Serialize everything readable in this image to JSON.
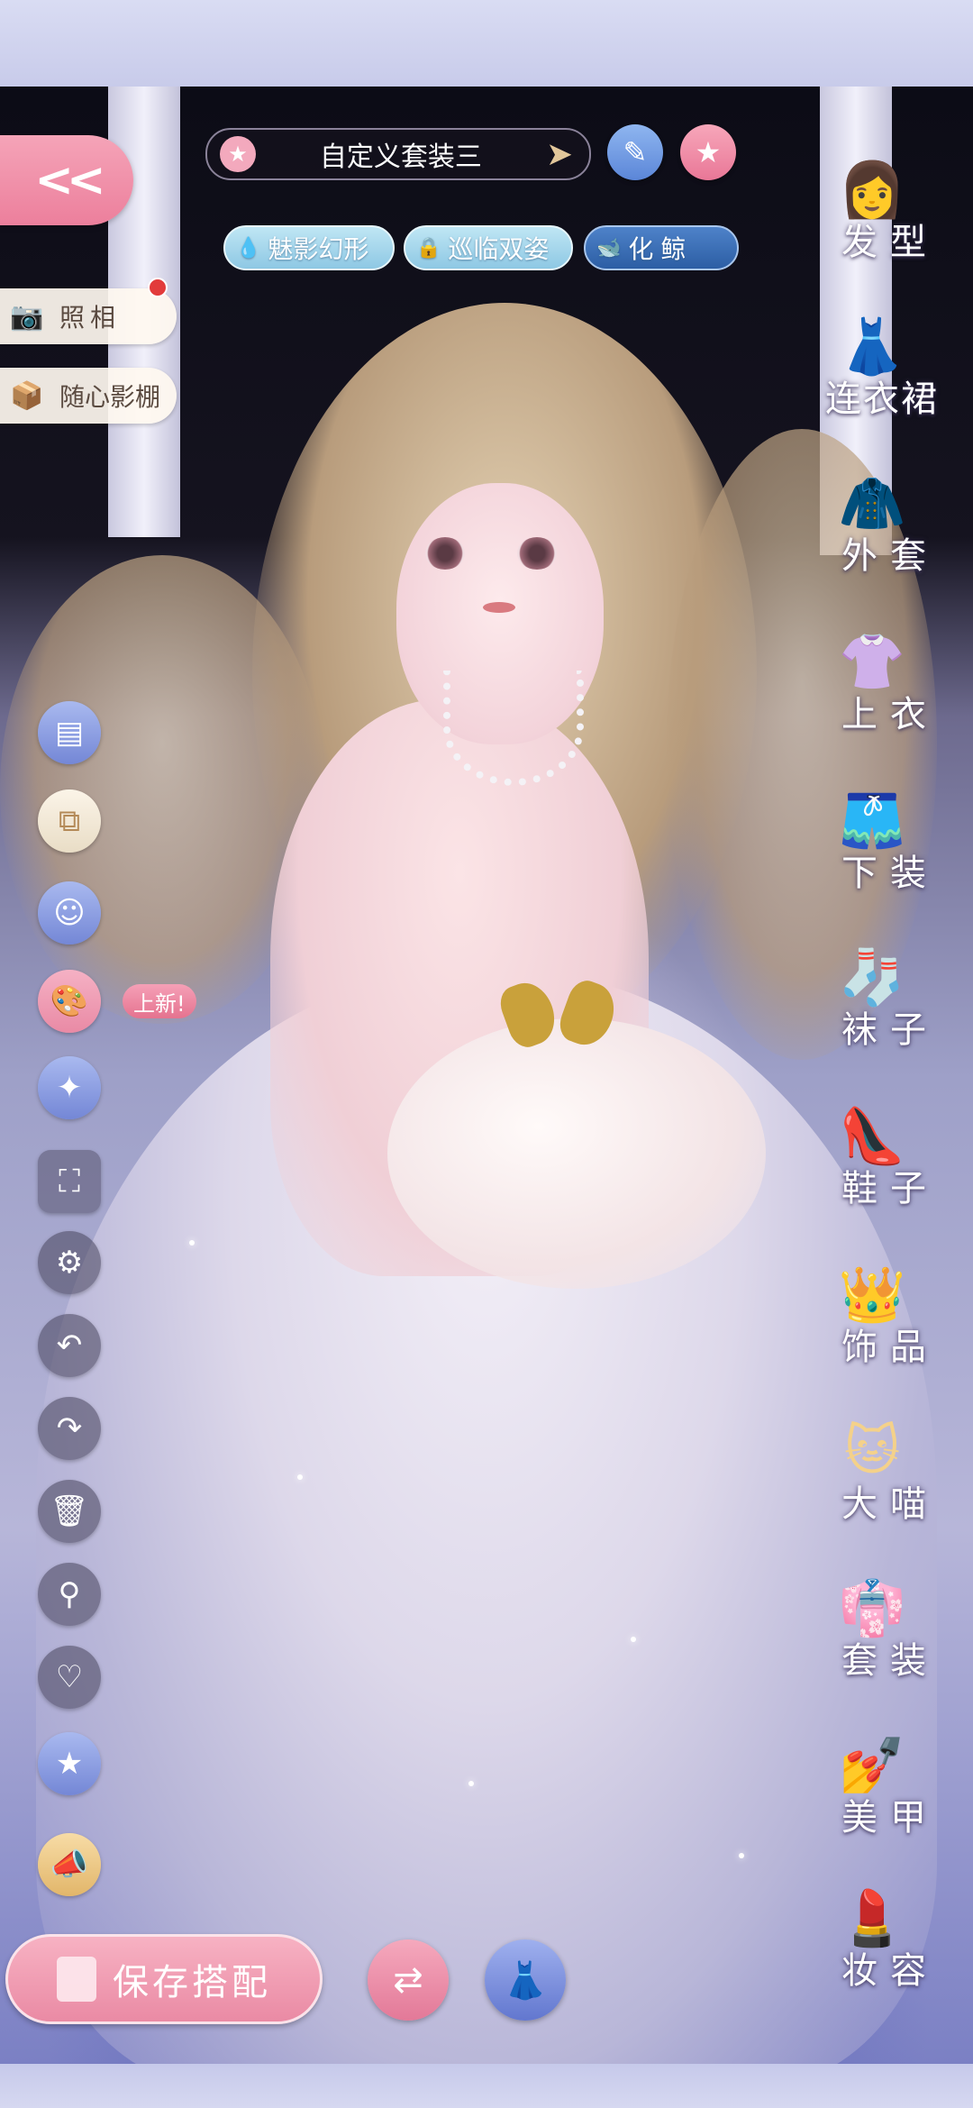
{
  "header": {
    "back_icon": "double-chevron-left-icon",
    "outfit_name": "自定义套装三",
    "outfit_star_icon": "star-icon",
    "outfit_next_icon": "chevron-right-icon",
    "edit_icon": "pencil-icon",
    "favorite_icon": "star-icon"
  },
  "chips": [
    {
      "label": "魅影幻形",
      "icon": "drop-icon"
    },
    {
      "label": "巡临双姿",
      "icon": "lock-icon"
    },
    {
      "label": "化鲸",
      "icon": "whale-icon"
    }
  ],
  "side_actions": {
    "photo": {
      "label": "照相",
      "icon": "camera-icon"
    },
    "studio": {
      "label": "随心影棚",
      "icon": "box-icon"
    }
  },
  "tools": {
    "new_badge": "上新!",
    "items": [
      "card-icon",
      "copy-icon",
      "person-list-icon",
      "palette-icon",
      "sparkle-star-icon",
      "fullscreen-icon",
      "settings-icon",
      "undo-icon",
      "redo-icon",
      "trash-icon",
      "search-icon",
      "heart-icon",
      "star-badge-icon",
      "megaphone-icon"
    ]
  },
  "categories": [
    {
      "label": "发型",
      "icon": "hairstyle-icon"
    },
    {
      "label": "连衣裙",
      "icon": "dress-icon"
    },
    {
      "label": "外套",
      "icon": "coat-icon"
    },
    {
      "label": "上衣",
      "icon": "shirt-icon"
    },
    {
      "label": "下装",
      "icon": "shorts-icon"
    },
    {
      "label": "袜子",
      "icon": "sock-icon"
    },
    {
      "label": "鞋子",
      "icon": "shoe-icon"
    },
    {
      "label": "饰品",
      "icon": "tiara-icon"
    },
    {
      "label": "大喵",
      "icon": "cat-icon"
    },
    {
      "label": "套装",
      "icon": "outfit-set-icon"
    },
    {
      "label": "美甲",
      "icon": "nail-polish-icon"
    },
    {
      "label": "妆容",
      "icon": "makeup-icon"
    }
  ],
  "footer": {
    "save_label": "保存搭配",
    "save_icon": "save-outfit-icon",
    "swap_icon": "swap-icon",
    "dress_icon": "dress-scan-icon"
  }
}
